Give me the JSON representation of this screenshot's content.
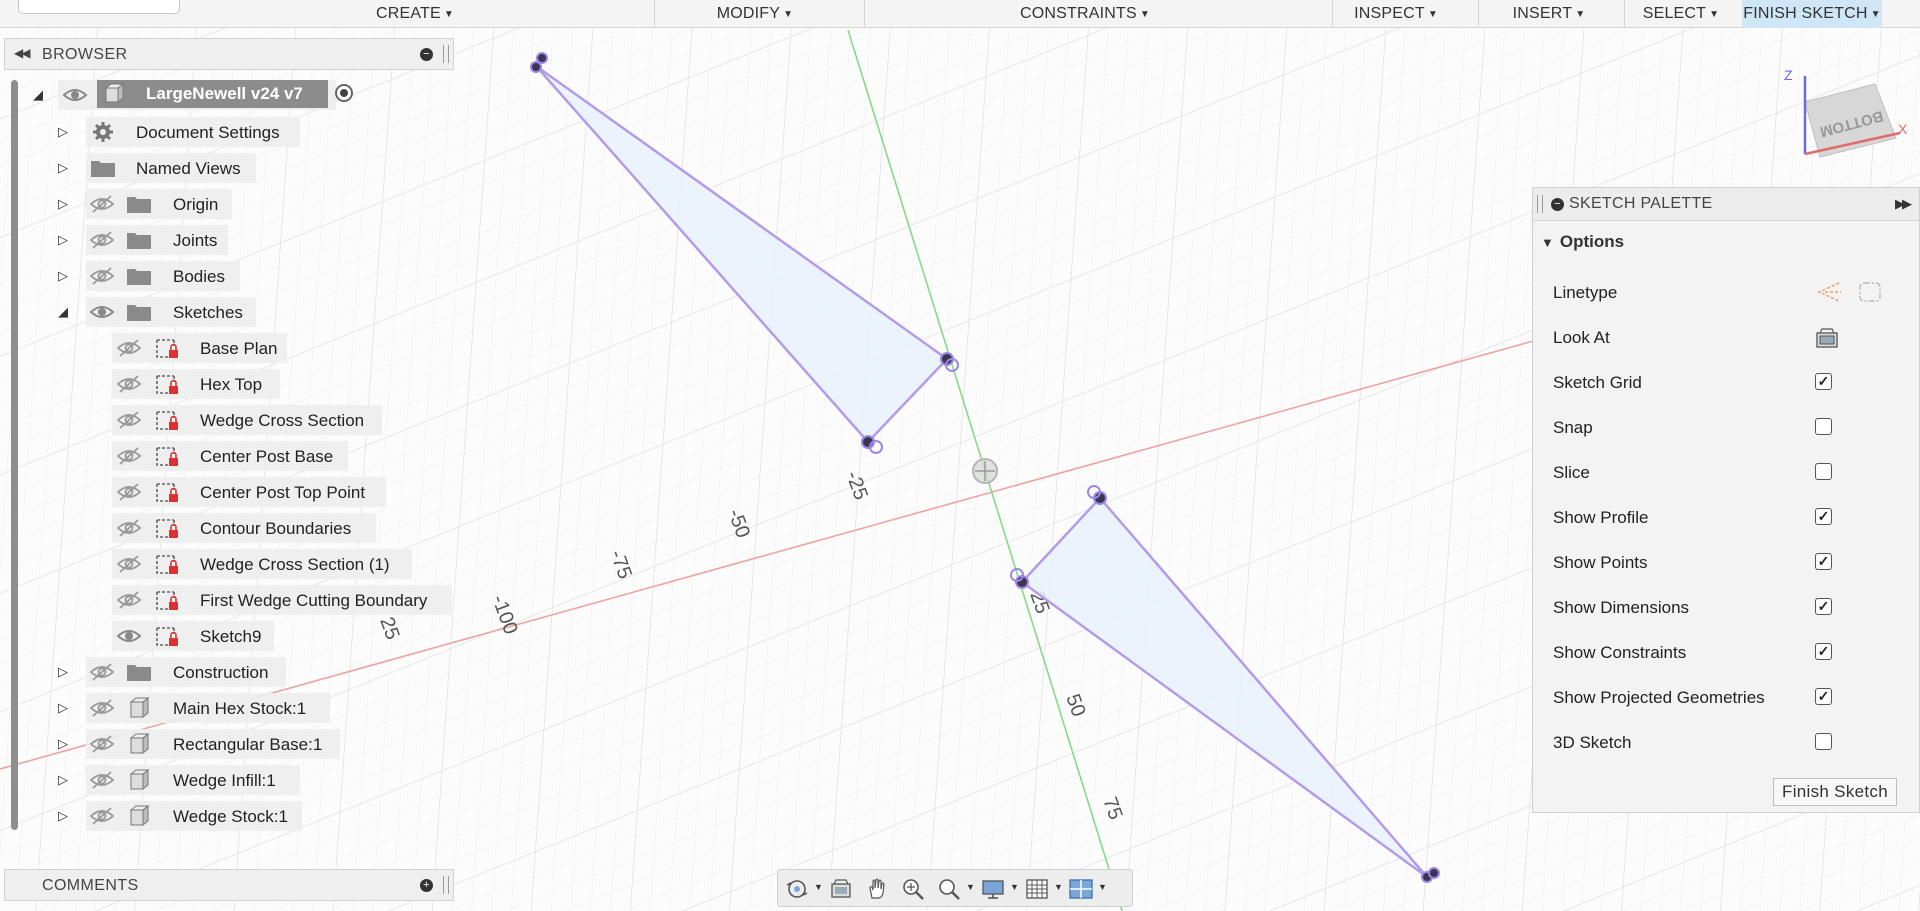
{
  "toolbar": {
    "items": [
      {
        "label": "CREATE"
      },
      {
        "label": "MODIFY"
      },
      {
        "label": "CONSTRAINTS"
      },
      {
        "label": "INSPECT"
      },
      {
        "label": "INSERT"
      },
      {
        "label": "SELECT"
      },
      {
        "label": "FINISH SKETCH"
      }
    ]
  },
  "browser": {
    "title": "BROWSER",
    "root": "LargeNewell v24 v7",
    "items": [
      {
        "label": "Document Settings",
        "icon": "gear-icon"
      },
      {
        "label": "Named Views",
        "icon": "folder-icon"
      },
      {
        "label": "Origin",
        "icon": "folder-icon"
      },
      {
        "label": "Joints",
        "icon": "folder-icon"
      },
      {
        "label": "Bodies",
        "icon": "folder-icon"
      },
      {
        "label": "Sketches",
        "icon": "folder-icon"
      },
      {
        "label": "Construction",
        "icon": "folder-icon"
      },
      {
        "label": "Main Hex Stock:1",
        "icon": "component-icon"
      },
      {
        "label": "Rectangular Base:1",
        "icon": "component-icon"
      },
      {
        "label": "Wedge Infill:1",
        "icon": "component-icon"
      },
      {
        "label": "Wedge Stock:1",
        "icon": "component-icon"
      }
    ],
    "sketches": [
      {
        "label": "Base Plan"
      },
      {
        "label": "Hex Top"
      },
      {
        "label": "Wedge Cross Section"
      },
      {
        "label": "Center Post Base"
      },
      {
        "label": "Center Post Top Point"
      },
      {
        "label": "Contour Boundaries"
      },
      {
        "label": "Wedge Cross Section (1)"
      },
      {
        "label": "First Wedge Cutting Boundary"
      },
      {
        "label": "Sketch9"
      }
    ]
  },
  "comments": {
    "title": "COMMENTS"
  },
  "palette": {
    "title": "SKETCH PALETTE",
    "section": "Options",
    "rows": [
      {
        "label": "Linetype",
        "kind": "icons"
      },
      {
        "label": "Look At",
        "kind": "icon"
      },
      {
        "label": "Sketch Grid",
        "checked": true
      },
      {
        "label": "Snap",
        "checked": false
      },
      {
        "label": "Slice",
        "checked": false
      },
      {
        "label": "Show Profile",
        "checked": true
      },
      {
        "label": "Show Points",
        "checked": true
      },
      {
        "label": "Show Dimensions",
        "checked": true
      },
      {
        "label": "Show Constraints",
        "checked": true
      },
      {
        "label": "Show Projected Geometries",
        "checked": true
      },
      {
        "label": "3D Sketch",
        "checked": false
      }
    ],
    "finish_button": "Finish Sketch"
  },
  "viewcube": {
    "face": "BOTTOM",
    "axis_z": "Z",
    "axis_x": "X"
  },
  "axis_ticks": {
    "x_axis": [
      "-100",
      "-75",
      "-50",
      "-25",
      "25"
    ],
    "y_axis": [
      "25",
      "50",
      "75"
    ]
  },
  "colors": {
    "x_axis": "#e8a0a0",
    "y_axis": "#7fd67f",
    "profile_fill": "#e8f2fc",
    "profile_stroke": "#b49be8",
    "toolbar_active": "#cfe6f7"
  }
}
